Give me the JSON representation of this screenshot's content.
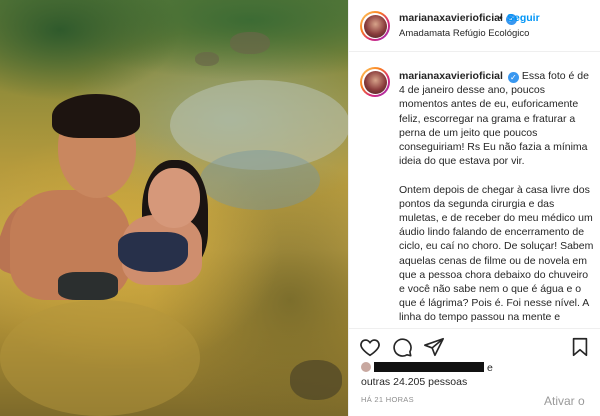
{
  "post": {
    "username": "marianaxavierioficial",
    "verified_icon": "verified-badge-icon",
    "separator": "•",
    "follow_label": "Seguir",
    "location": "Amadamata Refúgio Ecológico",
    "more_icon": "more-options-icon"
  },
  "caption": {
    "username": "marianaxavierioficial",
    "paragraphs": [
      "Essa foto é de 4 de janeiro desse ano, poucos momentos antes de eu, euforicamente feliz, escorregar na grama e fraturar a perna de um jeito que poucos conseguiriam! Rs Eu não fazia a mínima ideia do que estava por vir.",
      "Ontem depois de chegar à casa livre dos pontos da segunda cirurgia e das muletas, e de receber do meu médico um áudio lindo falando de encerramento de ciclo, eu caí no choro. De soluçar! Sabem aquelas cenas de filme ou de novela em que a pessoa chora debaixo do chuveiro e você não sabe nem o que é água e o que é lágrima? Pois é. Foi nesse nível. A linha do tempo passou na mente e"
    ]
  },
  "actions": {
    "like": "heart-icon",
    "comment": "comment-icon",
    "share": "share-icon",
    "save": "bookmark-icon"
  },
  "likes": {
    "suffix": "e",
    "others": "outras 24.205 pessoas"
  },
  "timestamp": "HÁ 21 HORAS",
  "watermark": "Ativar o",
  "colors": {
    "link_blue": "#0095f6",
    "verified_blue": "#3897f0",
    "text": "#262626",
    "muted": "#8e8e8e"
  }
}
